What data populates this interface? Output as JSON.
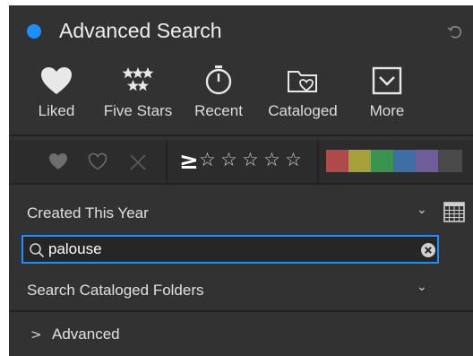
{
  "panel": {
    "title": "Advanced Search",
    "accent_color": "#1a8fff",
    "background": "#323232"
  },
  "quick_filters": [
    {
      "label": "Liked",
      "icon": "heart-icon"
    },
    {
      "label": "Five Stars",
      "icon": "five-stars-icon"
    },
    {
      "label": "Recent",
      "icon": "stopwatch-icon"
    },
    {
      "label": "Cataloged",
      "icon": "folder-heart-icon"
    },
    {
      "label": "More",
      "icon": "chevron-box-icon"
    }
  ],
  "filter_bar": {
    "flag_icons": [
      "filled-heart-icon",
      "outline-heart-icon",
      "reject-x-icon"
    ],
    "rating_operator": "≥",
    "rating_stars": [
      "☆",
      "☆",
      "☆",
      "☆",
      "☆"
    ],
    "color_labels": [
      {
        "name": "red",
        "color": "#b04a4a"
      },
      {
        "name": "yellow",
        "color": "#a6a03a"
      },
      {
        "name": "green",
        "color": "#3a9450"
      },
      {
        "name": "blue",
        "color": "#3d6fa6"
      },
      {
        "name": "purple",
        "color": "#6f5d99"
      },
      {
        "name": "none",
        "color": "#4a4a4a"
      }
    ]
  },
  "date_filter": {
    "value": "Created This Year",
    "chevron": "⌄"
  },
  "search": {
    "value": "palouse"
  },
  "scope": {
    "value": "Search Cataloged Folders",
    "chevron": "⌄"
  },
  "advanced": {
    "chevron": ">",
    "label": "Advanced"
  }
}
